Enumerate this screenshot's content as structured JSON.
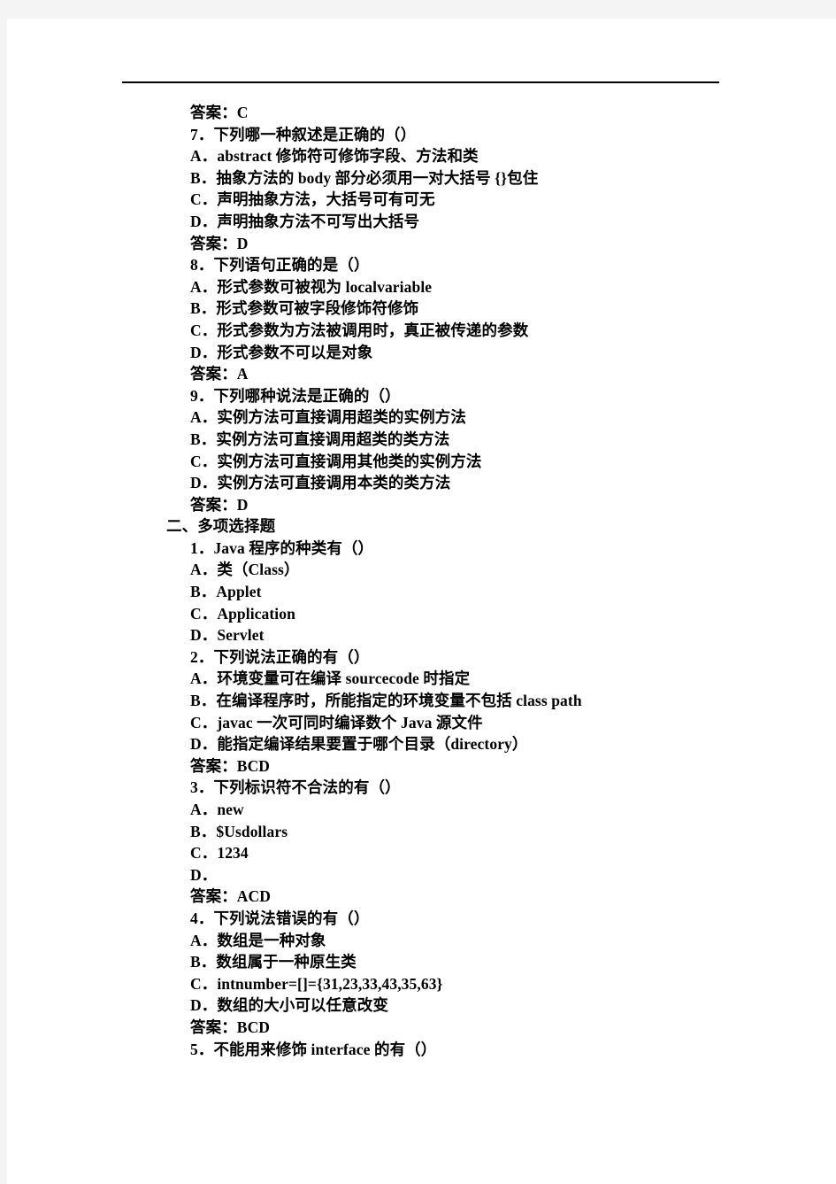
{
  "document": {
    "type": "exam-paper",
    "language": "zh-CN",
    "text_color": "#000000",
    "page_background": "#ffffff",
    "surround_background": "#f4f4f4",
    "rule_color": "#000000"
  },
  "sections": [
    {
      "id": "single-choice-continued",
      "heading": null,
      "lines": [
        {
          "kind": "answer",
          "text": "答案：C"
        },
        {
          "kind": "question",
          "text": "7．下列哪一种叙述是正确的（）"
        },
        {
          "kind": "option",
          "text": "A．abstract 修饰符可修饰字段、方法和类"
        },
        {
          "kind": "option",
          "text": "B．抽象方法的 body 部分必须用一对大括号 {}包住"
        },
        {
          "kind": "option",
          "text": "C．声明抽象方法，大括号可有可无"
        },
        {
          "kind": "option",
          "text": "D．声明抽象方法不可写出大括号"
        },
        {
          "kind": "answer",
          "text": "答案：D"
        },
        {
          "kind": "question",
          "text": "8．下列语句正确的是（）"
        },
        {
          "kind": "option",
          "text": "A．形式参数可被视为 localvariable"
        },
        {
          "kind": "option",
          "text": "B．形式参数可被字段修饰符修饰"
        },
        {
          "kind": "option",
          "text": "C．形式参数为方法被调用时，真正被传递的参数"
        },
        {
          "kind": "option",
          "text": "D．形式参数不可以是对象"
        },
        {
          "kind": "answer",
          "text": "答案：A"
        },
        {
          "kind": "question",
          "text": "9．下列哪种说法是正确的（）"
        },
        {
          "kind": "option",
          "text": "A．实例方法可直接调用超类的实例方法"
        },
        {
          "kind": "option",
          "text": "B．实例方法可直接调用超类的类方法"
        },
        {
          "kind": "option",
          "text": "C．实例方法可直接调用其他类的实例方法"
        },
        {
          "kind": "option",
          "text": "D．实例方法可直接调用本类的类方法"
        },
        {
          "kind": "answer",
          "text": "答案：D"
        }
      ]
    },
    {
      "id": "multiple-choice",
      "heading": "二、多项选择题",
      "lines": [
        {
          "kind": "question",
          "text": "1．Java 程序的种类有（）"
        },
        {
          "kind": "option",
          "text": "A．类（Class）"
        },
        {
          "kind": "option",
          "text": "B．Applet"
        },
        {
          "kind": "option",
          "text": "C．Application"
        },
        {
          "kind": "option",
          "text": "D．Servlet"
        },
        {
          "kind": "question",
          "text": "2．下列说法正确的有（）"
        },
        {
          "kind": "option",
          "text": "A．环境变量可在编译 sourcecode 时指定"
        },
        {
          "kind": "option",
          "text": "B．在编译程序时，所能指定的环境变量不包括 class path"
        },
        {
          "kind": "option",
          "text": "C．javac 一次可同时编译数个 Java 源文件"
        },
        {
          "kind": "option",
          "text": "D．能指定编译结果要置于哪个目录（directory）"
        },
        {
          "kind": "answer",
          "text": "答案：BCD"
        },
        {
          "kind": "question",
          "text": "3．下列标识符不合法的有（）"
        },
        {
          "kind": "option",
          "text": "A．new"
        },
        {
          "kind": "option",
          "text": "B．$Usdollars"
        },
        {
          "kind": "option",
          "text": "C．1234"
        },
        {
          "kind": "option",
          "text": "D．"
        },
        {
          "kind": "answer",
          "text": "答案：ACD"
        },
        {
          "kind": "question",
          "text": "4．下列说法错误的有（）"
        },
        {
          "kind": "option",
          "text": "A．数组是一种对象"
        },
        {
          "kind": "option",
          "text": "B．数组属于一种原生类"
        },
        {
          "kind": "option",
          "text": "C．intnumber=[]={31,23,33,43,35,63}"
        },
        {
          "kind": "option",
          "text": "D．数组的大小可以任意改变"
        },
        {
          "kind": "answer",
          "text": "答案：BCD"
        },
        {
          "kind": "question",
          "text": "5．不能用来修饰 interface 的有（）"
        }
      ]
    }
  ]
}
